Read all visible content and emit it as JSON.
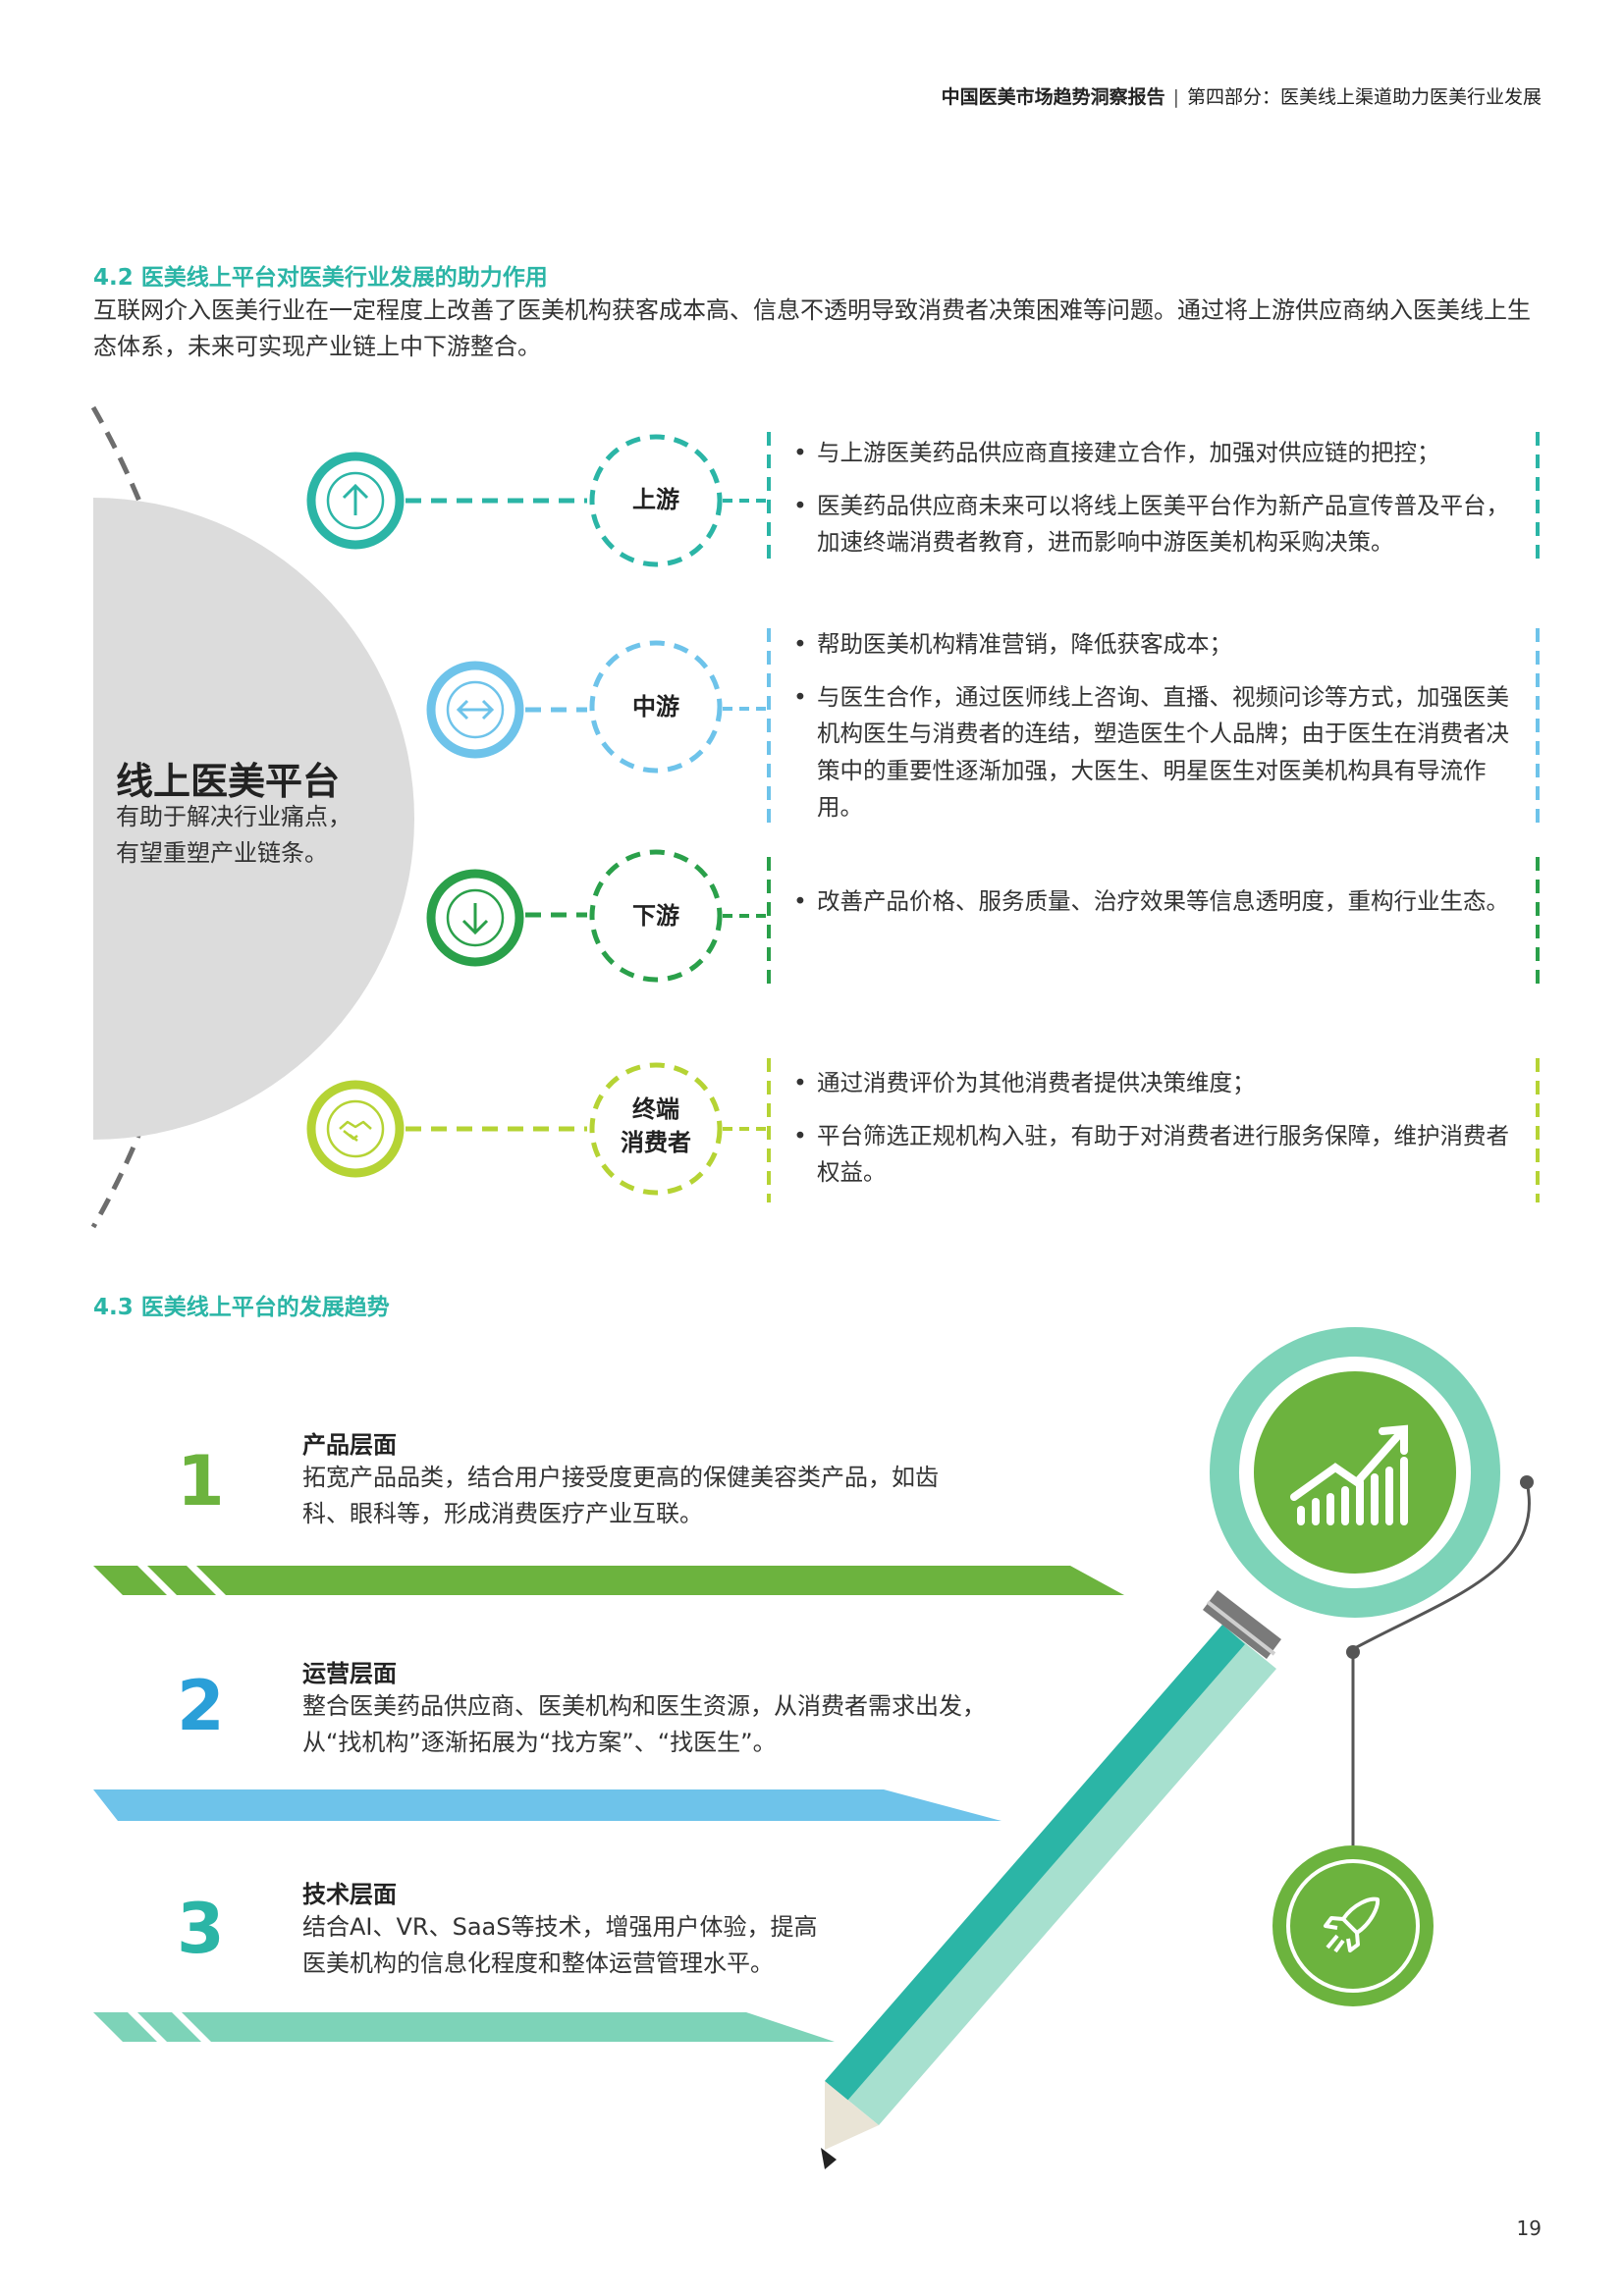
{
  "header": {
    "report_title": "中国医美市场趋势洞察报告",
    "section_title": "第四部分：医美线上渠道助力医美行业发展"
  },
  "section_42": {
    "title": "4.2 医美线上平台对医美行业发展的助力作用",
    "intro": "互联网介入医美行业在一定程度上改善了医美机构获客成本高、信息不透明导致消费者决策困难等问题。通过将上游供应商纳入医美线上生态体系，未来可实现产业链上中下游整合。"
  },
  "platform": {
    "title": "线上医美平台",
    "desc_line1": "有助于解决行业痛点，",
    "desc_line2": "有望重塑产业链条。"
  },
  "stages": [
    {
      "label": "上游",
      "color": "#2bb5a6",
      "icon": "arrow-up-icon",
      "bullets": [
        "与上游医美药品供应商直接建立合作，加强对供应链的把控；",
        "医美药品供应商未来可以将线上医美平台作为新产品宣传普及平台，加速终端消费者教育，进而影响中游医美机构采购决策。"
      ]
    },
    {
      "label": "中游",
      "color": "#6ec3ea",
      "icon": "arrows-left-right-icon",
      "bullets": [
        "帮助医美机构精准营销，降低获客成本；",
        "与医生合作，通过医师线上咨询、直播、视频问诊等方式，加强医美机构医生与消费者的连结，塑造医生个人品牌；由于医生在消费者决策中的重要性逐渐加强，大医生、明星医生对医美机构具有导流作用。"
      ]
    },
    {
      "label": "下游",
      "color": "#2aa04a",
      "icon": "arrow-down-icon",
      "bullets": [
        "改善产品价格、服务质量、治疗效果等信息透明度，重构行业生态。"
      ]
    },
    {
      "label_line1": "终端",
      "label_line2": "消费者",
      "color": "#b5d334",
      "icon": "handshake-icon",
      "bullets": [
        "通过消费评价为其他消费者提供决策维度；",
        "平台筛选正规机构入驻，有助于对消费者进行服务保障，维护消费者权益。"
      ]
    }
  ],
  "section_43": {
    "title": "4.3 医美线上平台的发展趋势"
  },
  "trends": [
    {
      "number": "1",
      "title": "产品层面",
      "line1": "拓宽产品品类，结合用户接受度更高的保健美容类产品，如齿",
      "line2": "科、眼科等，形成消费医疗产业互联。",
      "color": "#6cb33e"
    },
    {
      "number": "2",
      "title": "运营层面",
      "line1": "整合医美药品供应商、医美机构和医生资源，从消费者需求出发，",
      "line2": "从“找机构”逐渐拓展为“找方案”、“找医生”。",
      "color": "#6ec3ea"
    },
    {
      "number": "3",
      "title": "技术层面",
      "line1": "结合AI、VR、SaaS等技术，增强用户体验，提高",
      "line2": "医美机构的信息化程度和整体运营管理水平。",
      "color": "#2bb5a6"
    }
  ],
  "illustration": {
    "lens_icon": "growth-chart-icon",
    "badge_icon": "rocket-icon"
  },
  "page_number": "19"
}
